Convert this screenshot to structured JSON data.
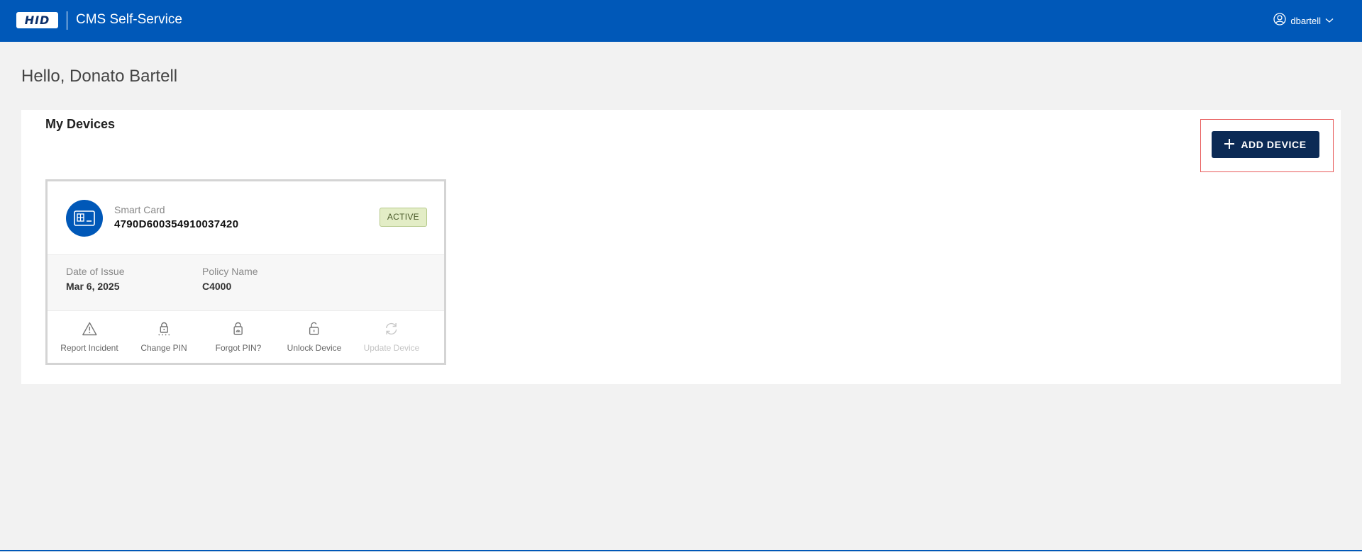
{
  "header": {
    "logo_text": "HID",
    "app_title": "CMS Self-Service",
    "user": {
      "name": "dbartell",
      "icon": "user-circle-icon",
      "chevron": "chevron-down-icon"
    },
    "background_color": "#0058b8"
  },
  "greeting": "Hello, Donato Bartell",
  "devices_panel": {
    "title": "My Devices",
    "add_button": {
      "label": "ADD DEVICE",
      "icon": "plus-icon",
      "color": "#0b2a55"
    },
    "devices": [
      {
        "icon": "smart-card-icon",
        "type": "Smart Card",
        "id": "4790D600354910037420",
        "status": "ACTIVE",
        "date_of_issue_label": "Date of Issue",
        "date_of_issue": "Mar 6, 2025",
        "policy_name_label": "Policy Name",
        "policy_name": "C4000",
        "actions": [
          {
            "label": "Report Incident",
            "icon": "warning-icon",
            "enabled": true
          },
          {
            "label": "Change PIN",
            "icon": "lock-pin-icon",
            "enabled": true
          },
          {
            "label": "Forgot PIN?",
            "icon": "lock-fingerprint-icon",
            "enabled": true
          },
          {
            "label": "Unlock Device",
            "icon": "unlock-icon",
            "enabled": true
          },
          {
            "label": "Update Device",
            "icon": "refresh-icon",
            "enabled": false
          }
        ]
      }
    ]
  },
  "colors": {
    "accent": "#0058b8",
    "status_active_bg": "#e3edc6",
    "highlight": "#e85a5a"
  }
}
